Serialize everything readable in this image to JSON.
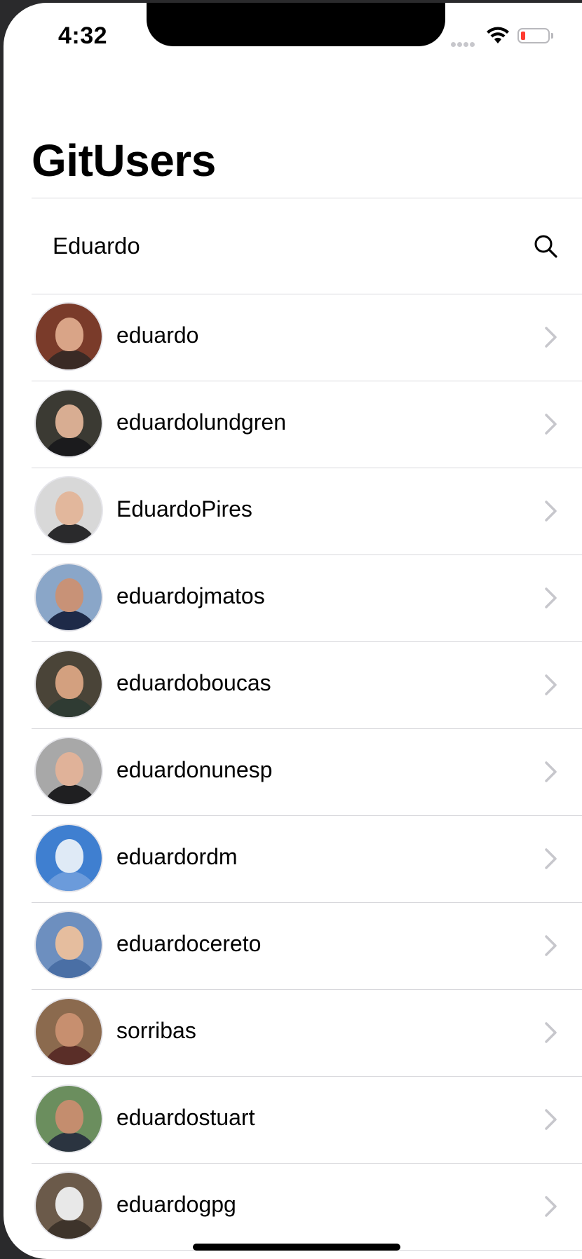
{
  "status_bar": {
    "time": "4:32"
  },
  "nav": {
    "title": "GitUsers"
  },
  "search": {
    "value": "Eduardo",
    "placeholder": ""
  },
  "users": [
    {
      "login": "eduardo",
      "avatar_colors": {
        "bg": "#7a3b2a",
        "face": "#d9a487",
        "body": "#3a2a25"
      }
    },
    {
      "login": "eduardolundgren",
      "avatar_colors": {
        "bg": "#3b3a33",
        "face": "#d8ad92",
        "body": "#1b1b1d"
      }
    },
    {
      "login": "EduardoPires",
      "avatar_colors": {
        "bg": "#d8d8d8",
        "face": "#e2b79c",
        "body": "#2a2a2c"
      }
    },
    {
      "login": "eduardojmatos",
      "avatar_colors": {
        "bg": "#8aa6c8",
        "face": "#c89277",
        "body": "#1e2a48"
      }
    },
    {
      "login": "eduardoboucas",
      "avatar_colors": {
        "bg": "#4a4438",
        "face": "#d3a07f",
        "body": "#2f3b33"
      }
    },
    {
      "login": "eduardonunesp",
      "avatar_colors": {
        "bg": "#a8a8a8",
        "face": "#e0b299",
        "body": "#1f1f21"
      }
    },
    {
      "login": "eduardordm",
      "avatar_colors": {
        "bg": "#3f7fd0",
        "face": "#dfeaf6",
        "body": "#6b9bdb"
      }
    },
    {
      "login": "eduardocereto",
      "avatar_colors": {
        "bg": "#6d8fbf",
        "face": "#e5bd9e",
        "body": "#4a6fa5"
      }
    },
    {
      "login": "sorribas",
      "avatar_colors": {
        "bg": "#8b6a4e",
        "face": "#c78f6f",
        "body": "#5a2e28"
      }
    },
    {
      "login": "eduardostuart",
      "avatar_colors": {
        "bg": "#6b8e5e",
        "face": "#c48d6e",
        "body": "#2b3440"
      }
    },
    {
      "login": "eduardogpg",
      "avatar_colors": {
        "bg": "#6b5a4a",
        "face": "#e8e8e8",
        "body": "#3e342b"
      }
    }
  ],
  "colors": {
    "separator": "#d8d8dc",
    "chevron": "#c7c7cc",
    "battery_low": "#ff3b30"
  },
  "icons": {
    "search": "search-icon",
    "chevron": "chevron-right-icon",
    "wifi": "wifi-icon",
    "battery": "battery-icon",
    "signal": "cellular-signal-icon"
  }
}
